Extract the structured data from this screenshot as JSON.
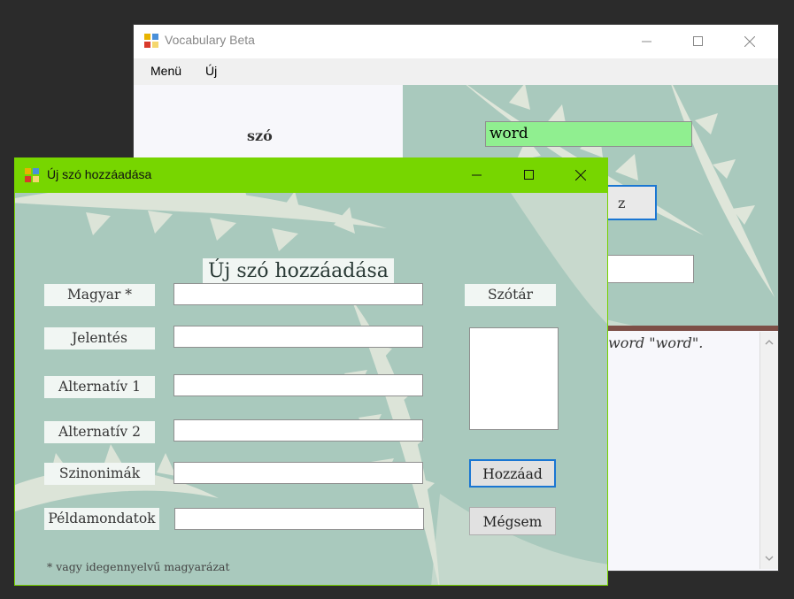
{
  "main_window": {
    "title": "Vocabulary Beta",
    "menu": [
      "Menü",
      "Új"
    ],
    "word_label": "szó",
    "word_input_value": "word",
    "search_button_label": "z",
    "result_text": "word \"word\"."
  },
  "dialog": {
    "title": "Új szó hozzáadása",
    "heading": "Új szó hozzáadása",
    "fields": [
      {
        "label": "Magyar *",
        "value": ""
      },
      {
        "label": "Jelentés",
        "value": ""
      },
      {
        "label": "Alternatív 1",
        "value": ""
      },
      {
        "label": "Alternatív 2",
        "value": ""
      },
      {
        "label": "Szinonimák",
        "value": ""
      },
      {
        "label": "Példamondatok",
        "value": ""
      }
    ],
    "dictionary_label": "Szótár",
    "add_button": "Hozzáad",
    "cancel_button": "Mégsem",
    "footnote": "* vagy idegennyelvű magyarázat"
  },
  "colors": {
    "dialog_titlebar": "#77d600",
    "word_input_bg": "#90ef90",
    "fern_bg": "#a9c9bd",
    "focus_border": "#1a76d2"
  }
}
